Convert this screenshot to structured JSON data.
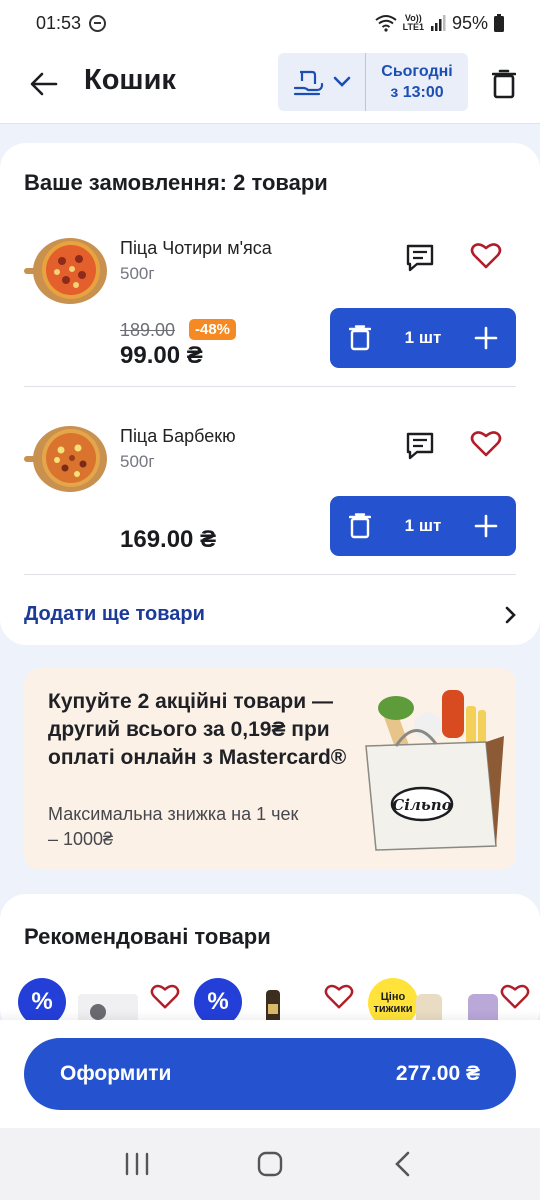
{
  "status_bar": {
    "time": "01:53",
    "battery": "95%",
    "network_top": "Vo))",
    "network_bottom": "LTE1"
  },
  "header": {
    "title": "Кошик",
    "delivery_day": "Сьогодні",
    "delivery_time": "з 13:00"
  },
  "order": {
    "title": "Ваше замовлення: 2 товари",
    "items": [
      {
        "name": "Піца Чотири м'яса",
        "weight": "500г",
        "old_price": "189.00",
        "discount": "-48%",
        "price": "99.00 ₴",
        "quantity": "1 шт"
      },
      {
        "name": "Піца Барбекю",
        "weight": "500г",
        "price": "169.00 ₴",
        "quantity": "1 шт"
      }
    ],
    "add_more": "Додати ще товари"
  },
  "promo": {
    "title": "Купуйте 2 акційні товари — другий всього за 0,19₴ при оплаті онлайн з Mastercard®",
    "subtitle": "Максимальна знижка на 1 чек – 1000₴",
    "bag_brand": "Сільпо"
  },
  "recommended": {
    "title": "Рекомендовані товари",
    "badge_text": "Ціно тижики",
    "percent_symbol": "%"
  },
  "checkout": {
    "label": "Оформити",
    "total": "277.00 ₴"
  },
  "colors": {
    "primary": "#2553cf",
    "link": "#1c3b99",
    "discount": "#f58a25",
    "favorite": "#b01e2a",
    "promo_bg": "#fcf1e6",
    "page_bg": "#eef2fb"
  }
}
